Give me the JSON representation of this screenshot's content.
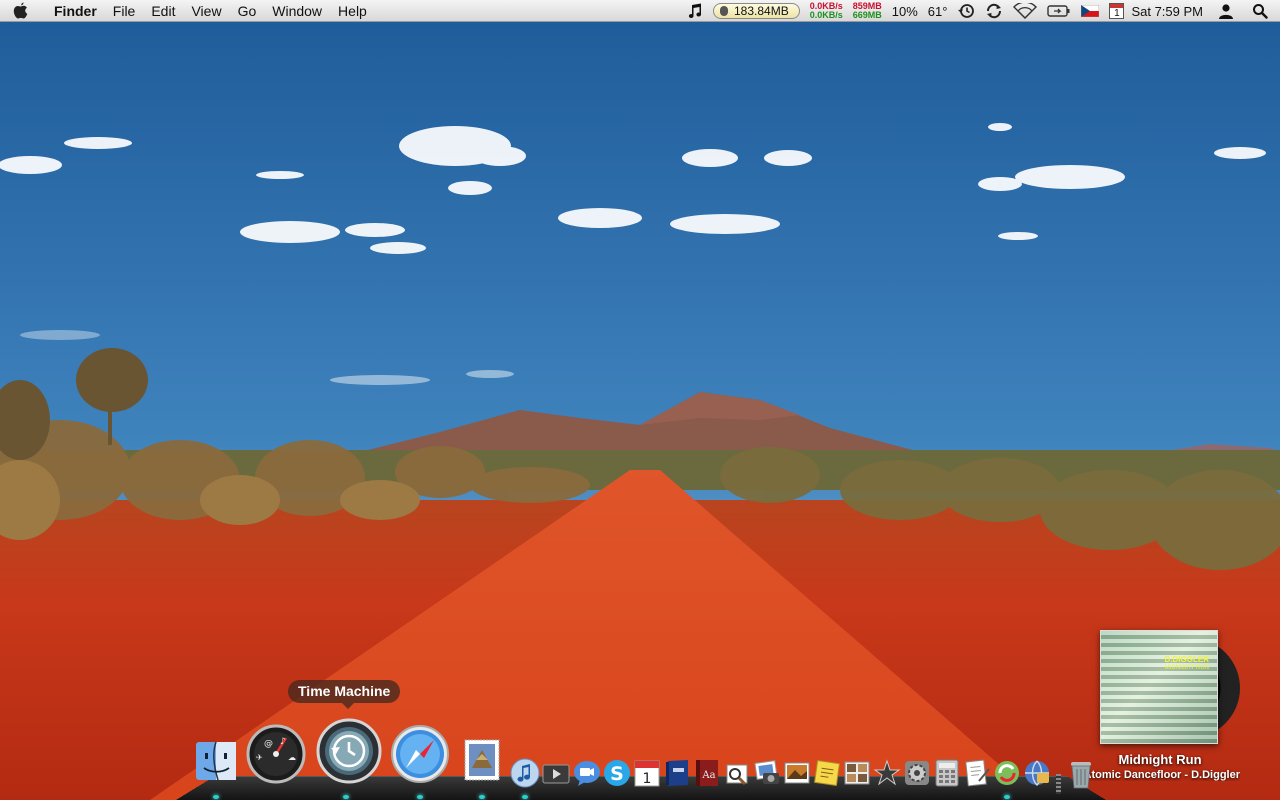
{
  "menubar": {
    "app_name": "Finder",
    "menus": [
      "File",
      "Edit",
      "View",
      "Go",
      "Window",
      "Help"
    ],
    "memory": "183.84MB",
    "net_up": "0.0KB/s",
    "net_down": "0.0KB/s",
    "mem_used": "859MB",
    "mem_free": "669MB",
    "cpu": "10%",
    "temperature": "61°",
    "calendar_day": "1",
    "clock": "Sat 7:59 PM"
  },
  "dock": {
    "tooltip": "Time Machine",
    "apps": [
      {
        "name": "Finder",
        "icon": "finder-icon"
      },
      {
        "name": "Dashboard",
        "icon": "dashboard-icon"
      },
      {
        "name": "Time Machine",
        "icon": "time-machine-icon"
      },
      {
        "name": "Safari",
        "icon": "safari-icon"
      },
      {
        "name": "Mail",
        "icon": "mail-icon"
      },
      {
        "name": "iTunes",
        "icon": "itunes-icon"
      },
      {
        "name": "Front Row",
        "icon": "front-row-icon"
      },
      {
        "name": "iChat",
        "icon": "ichat-icon"
      },
      {
        "name": "Skype",
        "icon": "skype-icon"
      },
      {
        "name": "iCal",
        "icon": "ical-icon"
      },
      {
        "name": "Address Book",
        "icon": "address-book-icon"
      },
      {
        "name": "Dictionary",
        "icon": "dictionary-icon"
      },
      {
        "name": "Preview",
        "icon": "preview-icon"
      },
      {
        "name": "iPhoto",
        "icon": "iphoto-icon"
      },
      {
        "name": "Image Capture",
        "icon": "image-capture-icon"
      },
      {
        "name": "Stickies",
        "icon": "stickies-icon"
      },
      {
        "name": "Photo Booth",
        "icon": "photo-booth-icon"
      },
      {
        "name": "iMovie",
        "icon": "imovie-icon"
      },
      {
        "name": "System Preferences",
        "icon": "system-preferences-icon"
      },
      {
        "name": "Calculator",
        "icon": "calculator-icon"
      },
      {
        "name": "TextEdit",
        "icon": "textedit-icon"
      },
      {
        "name": "Sync",
        "icon": "sync-icon"
      },
      {
        "name": "Network",
        "icon": "network-icon"
      },
      {
        "name": "Trash",
        "icon": "trash-icon"
      }
    ]
  },
  "now_playing": {
    "track": "Midnight Run",
    "artist_line": "Atomic Dancefloor - D.Diggler",
    "cover_artist": "D.DIGGLER",
    "cover_subtitle": "MIDNIGHT RUN"
  },
  "colors": {
    "sky_top": "#1f5f9e",
    "sky_bottom": "#8ab8d8",
    "road": "#c4361a",
    "dock_light": "#2ad0d0"
  }
}
